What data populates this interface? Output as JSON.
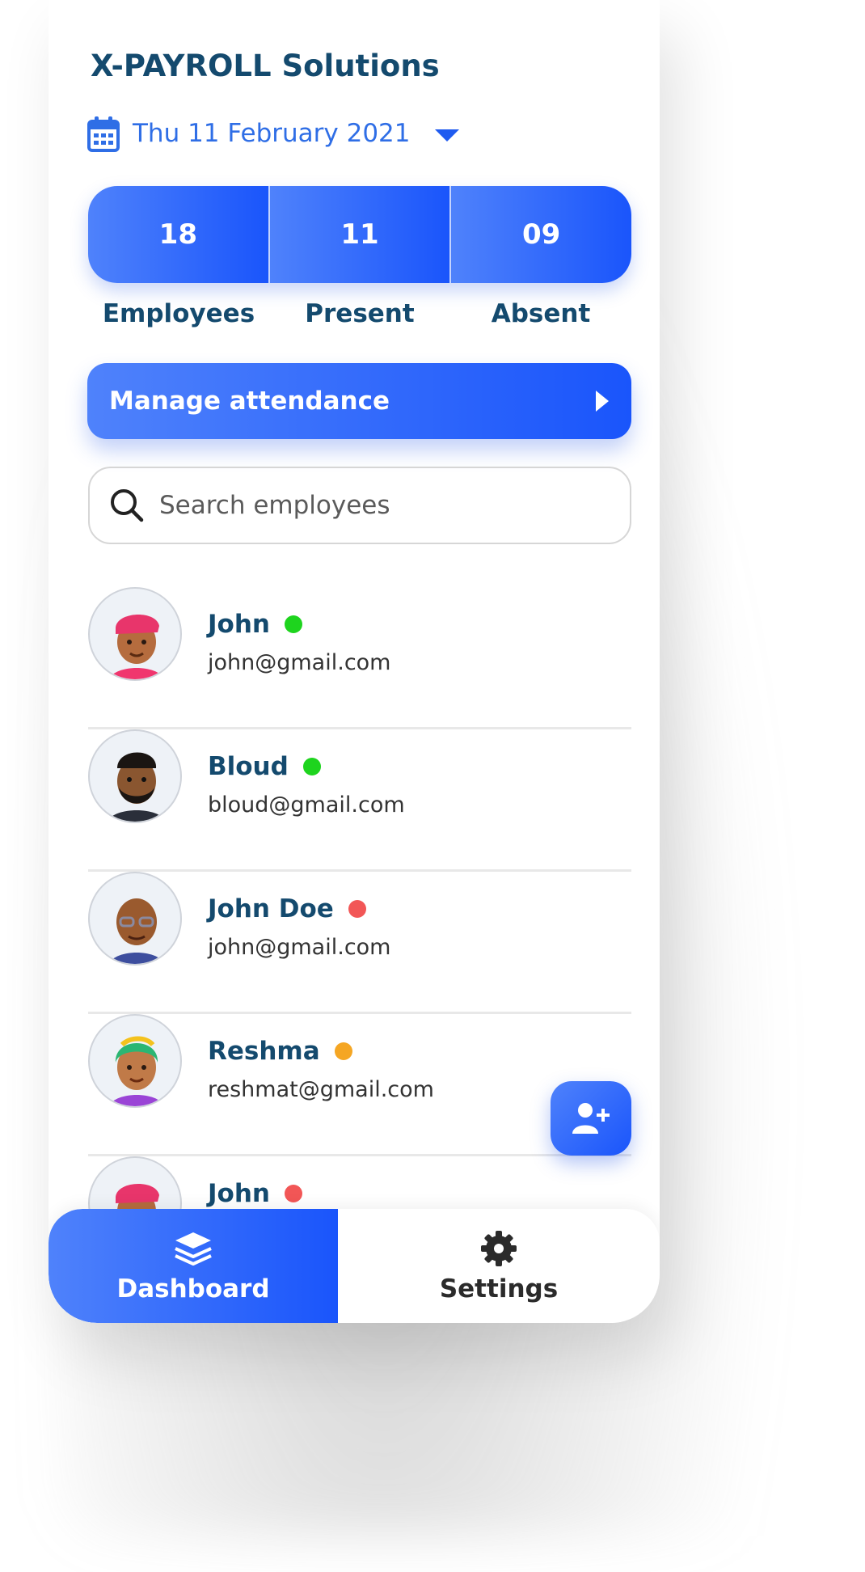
{
  "app": {
    "title": "X-PAYROLL Solutions"
  },
  "date": {
    "label": "Thu 11 February 2021"
  },
  "stats": [
    {
      "value": "18",
      "label": "Employees"
    },
    {
      "value": "11",
      "label": "Present"
    },
    {
      "value": "09",
      "label": "Absent"
    }
  ],
  "manage": {
    "label": "Manage attendance"
  },
  "search": {
    "placeholder": "Search employees"
  },
  "employees": [
    {
      "name": "John",
      "email": "john@gmail.com",
      "status_color": "#1ed41e"
    },
    {
      "name": "Bloud",
      "email": "bloud@gmail.com",
      "status_color": "#1ed41e"
    },
    {
      "name": "John Doe",
      "email": "john@gmail.com",
      "status_color": "#f25656"
    },
    {
      "name": "Reshma",
      "email": "reshmat@gmail.com",
      "status_color": "#f5a623"
    },
    {
      "name": "John",
      "email": "",
      "status_color": "#f25656"
    }
  ],
  "tabs": {
    "dashboard": "Dashboard",
    "settings": "Settings"
  },
  "colors": {
    "primary": "#1a55fb",
    "title": "#144a6e",
    "accent_text": "#2f6ee6"
  }
}
